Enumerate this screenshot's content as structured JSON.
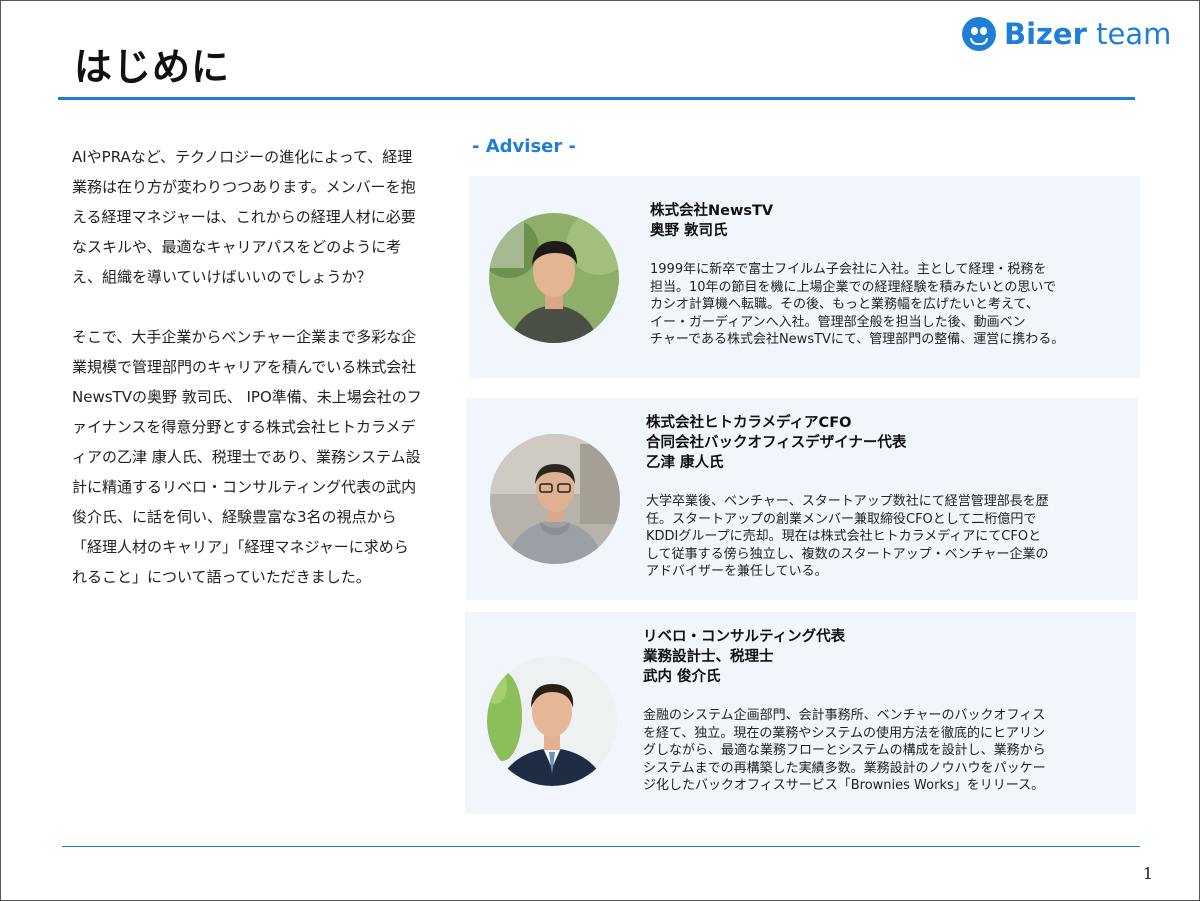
{
  "page": {
    "title": "はじめに",
    "page_number": "1"
  },
  "logo": {
    "brand_bold": "Bizer",
    "brand_light": "team",
    "icon": "bizer-smile-icon",
    "accent_color": "#1f7fd6"
  },
  "intro": {
    "paragraph_1": "AIやPRAなど、テクノロジーの進化によって、経理業務は在り方が変わりつつあります。メンバーを抱える経理マネジャーは、これからの経理人材に必要なスキルや、最適なキャリアパスをどのように考え、組織を導いていけばいいのでしょうか？",
    "paragraph_2": "そこで、大手企業からベンチャー企業まで多彩な企業規模で管理部門のキャリアを積んでいる株式会社NewsTVの奥野 敦司氏、 IPO準備、未上場会社のファイナンスを得意分野とする株式会社ヒトカラメディアの乙津 康人氏、税理士であり、業務システム設計に精通するリベロ・コンサルティング代表の武内 俊介氏、に話を伺い、経験豊富な3名の視点から「経理人材のキャリア」「経理マネジャーに求められること」について語っていただきました。"
  },
  "adviser_heading": "- Adviser -",
  "advisers": [
    {
      "affiliations": [
        "株式会社NewsTV"
      ],
      "name": "奥野 敦司氏",
      "bio_lines": [
        "1999年に新卒で富士フイルム子会社に入社。主として経理・税務を",
        "担当。10年の節目を機に上場企業での経理経験を積みたいとの思いで",
        "カシオ計算機へ転職。その後、もっと業務幅を広げたいと考えて、",
        "イー・ガーディアンへ入社。管理部全般を担当した後、動画ベン",
        "チャーである株式会社NewsTVにて、管理部門の整備、運営に携わる。"
      ]
    },
    {
      "affiliations": [
        "株式会社ヒトカラメディアCFO",
        "合同会社バックオフィスデザイナー代表"
      ],
      "name": "乙津 康人氏",
      "bio_lines": [
        "大学卒業後、ベンチャー、スタートアップ数社にて経営管理部長を歴",
        "任。スタートアップの創業メンバー兼取締役CFOとして二桁億円で",
        "KDDIグループに売却。現在は株式会社ヒトカラメディアにてCFOと",
        "して従事する傍ら独立し、複数のスタートアップ・ベンチャー企業の",
        "アドバイザーを兼任している。"
      ]
    },
    {
      "affiliations": [
        "リベロ・コンサルティング代表",
        "業務設計士、税理士"
      ],
      "name": "武内 俊介氏",
      "bio_lines": [
        "金融のシステム企画部門、会計事務所、ベンチャーのバックオフィス",
        "を経て、独立。現在の業務やシステムの使用方法を徹底的にヒアリン",
        "グしながら、最適な業務フローとシステムの構成を設計し、業務から",
        "システムまでの再構築した実績多数。業務設計のノウハウをパッケー",
        "ジ化したバックオフィスサービス「Brownies Works」をリリース。"
      ]
    }
  ]
}
